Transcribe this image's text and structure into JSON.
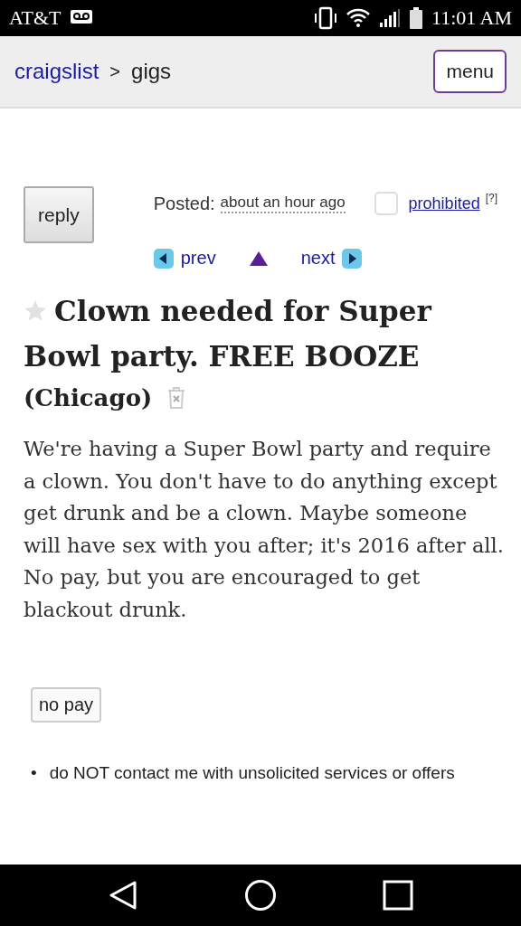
{
  "status_bar": {
    "carrier": "AT&T",
    "time": "11:01 AM"
  },
  "header": {
    "home_link": "craigslist",
    "separator": ">",
    "category": "gigs",
    "menu_button": "menu"
  },
  "reply_button": "reply",
  "posted": {
    "label": "Posted:",
    "value": "about an hour ago"
  },
  "flag": {
    "checked": false,
    "label": "prohibited",
    "help": "[?]"
  },
  "nav": {
    "prev": "prev",
    "next": "next"
  },
  "posting": {
    "starred": false,
    "title": "Clown needed for Super Bowl party. FREE BOOZE",
    "location": "(Chicago)",
    "body": "We're having a Super Bowl party and require a clown. You don't have to do anything except get drunk and be a clown. Maybe someone will have sex with you after; it's 2016 after all. No pay, but you are encouraged to get blackout drunk.",
    "attributes": [
      "no pay"
    ],
    "notices": [
      {
        "bullet": "•",
        "text": "do NOT contact me with unsolicited services or offers"
      }
    ]
  }
}
